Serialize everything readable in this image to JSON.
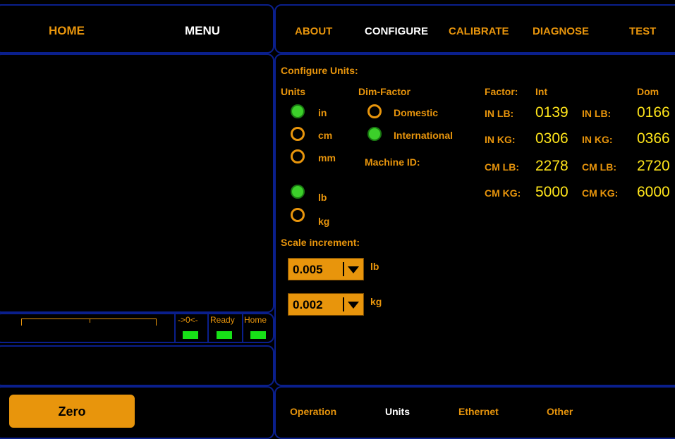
{
  "top_left": {
    "home": "HOME",
    "menu": "MENU"
  },
  "top_nav": {
    "about": "ABOUT",
    "configure": "CONFIGURE",
    "calibrate": "CALIBRATE",
    "diagnose": "DIAGNOSE",
    "test": "TEST"
  },
  "status": {
    "zero_label": "->0<-",
    "ready_label": "Ready",
    "home_label": "Home"
  },
  "zero_button": "Zero",
  "config": {
    "title": "Configure Units:",
    "units_header": "Units",
    "dim_header": "Dim-Factor",
    "factor_header": "Factor:",
    "int_header": "Int",
    "dom_header": "Dom",
    "unit_in": "in",
    "unit_cm": "cm",
    "unit_mm": "mm",
    "unit_lb": "lb",
    "unit_kg": "kg",
    "dim_domestic": "Domestic",
    "dim_international": "International",
    "machine_id": "Machine ID:",
    "rows": [
      {
        "int_label": "IN LB:",
        "int_value": "0139",
        "dom_label": "IN LB:",
        "dom_value": "0166"
      },
      {
        "int_label": "IN KG:",
        "int_value": "0306",
        "dom_label": "IN KG:",
        "dom_value": "0366"
      },
      {
        "int_label": "CM LB:",
        "int_value": "2278",
        "dom_label": "CM LB:",
        "dom_value": "2720"
      },
      {
        "int_label": "CM KG:",
        "int_value": "5000",
        "dom_label": "CM KG:",
        "dom_value": "6000"
      }
    ],
    "scale_increment": "Scale increment:",
    "lb_increment": "0.005",
    "lb_unit": "lb",
    "kg_increment": "0.002",
    "kg_unit": "kg"
  },
  "bottom_tabs": {
    "operation": "Operation",
    "units": "Units",
    "ethernet": "Ethernet",
    "other": "Other"
  },
  "colors": {
    "accent": "#e8950c",
    "active": "#ffffff",
    "value": "#ffe51a",
    "indicator": "#17e017",
    "border": "#0a1f8c"
  }
}
